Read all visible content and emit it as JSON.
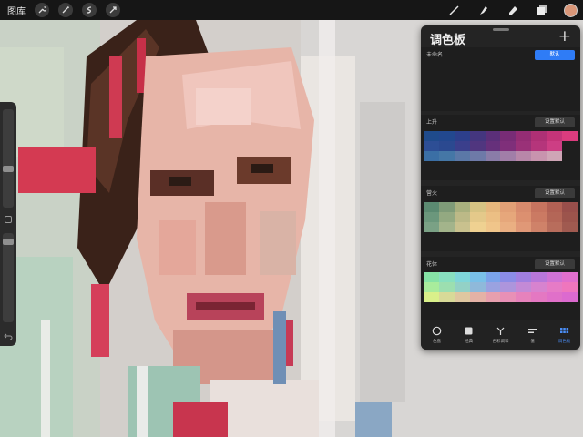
{
  "topbar": {
    "gallery_label": "图库",
    "left_tools": [
      "wrench-icon",
      "magic-wand-icon",
      "selection-icon",
      "move-icon"
    ],
    "right_tools": [
      "brush-icon",
      "smudge-icon",
      "eraser-icon",
      "layers-icon"
    ],
    "current_color": "#d99678"
  },
  "panel": {
    "title": "调色板",
    "add_icon": "+",
    "palettes": [
      {
        "name": "未命名",
        "button": "默认",
        "is_default": true,
        "colors": []
      },
      {
        "name": "上升",
        "button": "设置默认",
        "is_default": false,
        "colors": [
          "#1f4b8c",
          "#22488f",
          "#2d3f8c",
          "#44367f",
          "#5b2f79",
          "#782c76",
          "#942d74",
          "#ae3075",
          "#c53479",
          "#db3c7e",
          "#2d4e95",
          "#2b4990",
          "#3b3f8c",
          "#50367f",
          "#66307b",
          "#7f2f7a",
          "#9a3178",
          "#b5357b",
          "#cd3e84",
          "",
          "#3b6fa5",
          "#4577a6",
          "#5b78a7",
          "#6e7aa8",
          "#8a7ca8",
          "#a17ea8",
          "#b887a9",
          "#c894ae",
          "#cfa5b6",
          ""
        ]
      },
      {
        "name": "营火",
        "button": "设置默认",
        "is_default": false,
        "colors": [
          "#5b8a71",
          "#7f9b78",
          "#a9b07e",
          "#d6c383",
          "#e6b77d",
          "#e2a076",
          "#d88b6d",
          "#c7745f",
          "#b26154",
          "#994f4b",
          "#6b977c",
          "#93a981",
          "#bcb987",
          "#e4c98a",
          "#ecbf84",
          "#e6a77b",
          "#dc9070",
          "#cb7a63",
          "#b46657",
          "#9c544c",
          "#7aa185",
          "#a3b48b",
          "#c9c18e",
          "#efd191",
          "#f0c58a",
          "#eaaf82",
          "#e09877",
          "#cf8269",
          "#b86d5c",
          "#a05a50"
        ]
      },
      {
        "name": "花体",
        "button": "设置默认",
        "is_default": false,
        "colors": [
          "#86e3a6",
          "#88e0c0",
          "#7fd6da",
          "#79c0e8",
          "#7aa3ea",
          "#8b8ce6",
          "#a07fe0",
          "#b877da",
          "#cf73d5",
          "#e06fcd",
          "#a8ec9c",
          "#9cdfb0",
          "#93d1c6",
          "#8fb9da",
          "#9aa2e0",
          "#ad95dc",
          "#c38ad6",
          "#d783cf",
          "#e67bc6",
          "#ef76bd",
          "#d9f08a",
          "#d8da98",
          "#dfc7a0",
          "#e4b2a6",
          "#e79fae",
          "#e890b6",
          "#e682bc",
          "#e478c2",
          "#e070c9",
          "#dc6acf"
        ]
      }
    ],
    "tabs": [
      {
        "label": "色盘",
        "icon": "disc-icon",
        "active": false
      },
      {
        "label": "经典",
        "icon": "square-icon",
        "active": false
      },
      {
        "label": "色彩调和",
        "icon": "harmony-icon",
        "active": false
      },
      {
        "label": "值",
        "icon": "sliders-icon",
        "active": false
      },
      {
        "label": "调色板",
        "icon": "palettes-icon",
        "active": true
      }
    ]
  }
}
